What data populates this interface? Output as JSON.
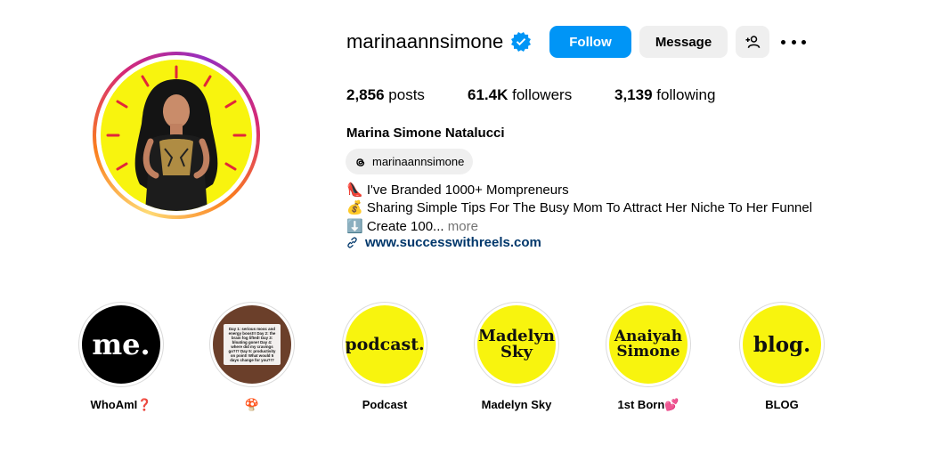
{
  "profile": {
    "username": "marinaannsimone",
    "verified": true,
    "follow_label": "Follow",
    "message_label": "Message",
    "posts_count": "2,856",
    "posts_label": "posts",
    "followers_count": "61.4K",
    "followers_label": "followers",
    "following_count": "3,139",
    "following_label": "following",
    "full_name": "Marina Simone Natalucci",
    "threads_handle": "marinaannsimone",
    "bio": [
      "👠 I've Branded 1000+ Mompreneurs",
      "💰 Sharing Simple Tips For The Busy Mom To Attract Her Niche To Her Funnel",
      "⬇️ Create 100..."
    ],
    "more_label": "more",
    "website": "www.successwithreels.com"
  },
  "highlights": [
    {
      "cover_text": "me.",
      "label": "WhoAmI❓"
    },
    {
      "cover_text": "Day 1: serious mooc and energy boost!! Day 2: the brain fog lifted! Day 3: bloating gone! Day 4: where did my cravings go?!? Day 5: productivity on point! What would 5 days change for you?!?",
      "label": "🍄"
    },
    {
      "cover_text": "podcast.",
      "label": "Podcast"
    },
    {
      "cover_text": "Madelyn Sky",
      "label": "Madelyn Sky"
    },
    {
      "cover_text": "Anaiyah Simone",
      "label": "1st Born💕"
    },
    {
      "cover_text": "blog.",
      "label": "BLOG"
    }
  ],
  "colors": {
    "follow_blue": "#0095f6",
    "highlight_yellow": "#f8f40e",
    "link_blue": "#00376b",
    "verified_blue": "#0095f6"
  }
}
